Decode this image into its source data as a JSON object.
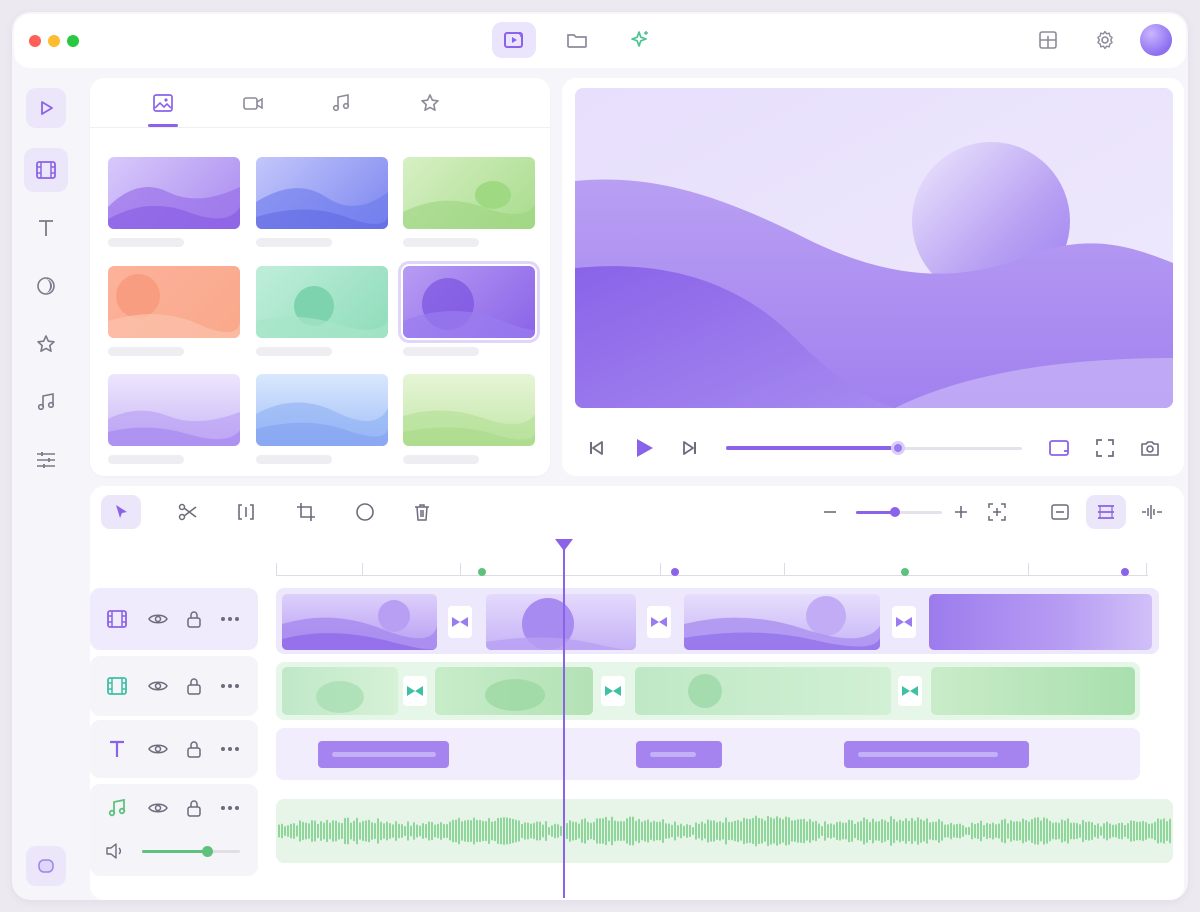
{
  "colors": {
    "accent": "#8a63e8",
    "accent_light": "#ece6fb",
    "green": "#5ec27c",
    "teal": "#3fbfa4",
    "window_bg": "#f6f5f9"
  },
  "window_controls": [
    "close",
    "minimize",
    "maximize"
  ],
  "top_bar": {
    "center_buttons": [
      {
        "icon": "video-editor-icon",
        "active": true
      },
      {
        "icon": "folder-icon",
        "active": false
      },
      {
        "icon": "sparkle-ai-icon",
        "active": false
      }
    ],
    "right_buttons": [
      "layout-icon",
      "settings-gear-icon",
      "user-avatar"
    ]
  },
  "sidebar": {
    "items": [
      {
        "icon": "play-icon",
        "active": false
      },
      {
        "icon": "film-strip-icon",
        "active": true
      },
      {
        "icon": "text-icon",
        "active": false
      },
      {
        "icon": "transition-icon",
        "active": false
      },
      {
        "icon": "star-icon",
        "active": false
      },
      {
        "icon": "music-icon",
        "active": false
      },
      {
        "icon": "adjustments-icon",
        "active": false
      }
    ],
    "bottom_icon": "chat-icon"
  },
  "media_library": {
    "tabs": [
      {
        "icon": "image-icon",
        "active": true
      },
      {
        "icon": "video-icon",
        "active": false
      },
      {
        "icon": "music-icon",
        "active": false
      },
      {
        "icon": "star-icon",
        "active": false
      }
    ],
    "selected_thumbnail": 5
  },
  "preview": {
    "controls": [
      "skip-back-icon",
      "play-icon",
      "skip-forward-icon"
    ],
    "progress": 0.58,
    "right_controls": [
      "aspect-ratio-icon",
      "fullscreen-icon",
      "snapshot-camera-icon"
    ]
  },
  "timeline": {
    "tools": [
      {
        "icon": "select-cursor-icon",
        "active": true
      },
      {
        "icon": "scissors-icon",
        "active": false
      },
      {
        "icon": "split-icon",
        "active": false
      },
      {
        "icon": "crop-icon",
        "active": false
      },
      {
        "icon": "circle-mask-icon",
        "active": false
      },
      {
        "icon": "trash-icon",
        "active": false
      }
    ],
    "zoom_level": 0.45,
    "view_buttons": [
      {
        "icon": "collapse-tracks-icon",
        "active": false
      },
      {
        "icon": "expand-tracks-icon",
        "active": true
      },
      {
        "icon": "audio-waveform-icon",
        "active": false
      }
    ],
    "tracks": [
      {
        "type": "video",
        "icon": "film-strip-icon",
        "color": "#8a63e8",
        "clips": 4,
        "transitions": 3
      },
      {
        "type": "overlay-video",
        "icon": "film-strip-icon",
        "color": "#3fbfa4",
        "clips": 4,
        "transitions": 3
      },
      {
        "type": "text",
        "icon": "text-icon",
        "color": "#8a63e8",
        "clips": 3
      },
      {
        "type": "audio",
        "icon": "music-icon",
        "color": "#5ec27c",
        "volume": 0.66
      }
    ],
    "track_actions": [
      "eye-icon",
      "lock-icon",
      "more-icon"
    ]
  }
}
